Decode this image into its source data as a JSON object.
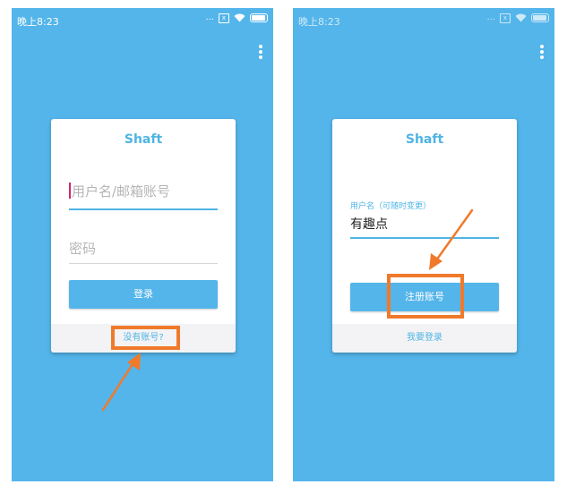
{
  "status_bar": {
    "time": "晚上8:23",
    "dots": "...",
    "sim": "x"
  },
  "login_screen": {
    "app_title": "Shaft",
    "username_placeholder": "用户名/邮箱账号",
    "password_placeholder": "密码",
    "login_button": "登录",
    "no_account_link": "没有账号?"
  },
  "register_screen": {
    "app_title": "Shaft",
    "username_label": "用户名（可随时变更）",
    "username_value": "有趣点",
    "register_button": "注册账号",
    "to_login_link": "我要登录"
  },
  "colors": {
    "background": "#54b5ea",
    "accent": "#4fb4e4",
    "annotation": "#f07a2b"
  },
  "icons": [
    "signal-dots-icon",
    "sim-icon",
    "wifi-icon",
    "battery-icon",
    "overflow-menu-icon",
    "annotation-arrow-icon"
  ]
}
